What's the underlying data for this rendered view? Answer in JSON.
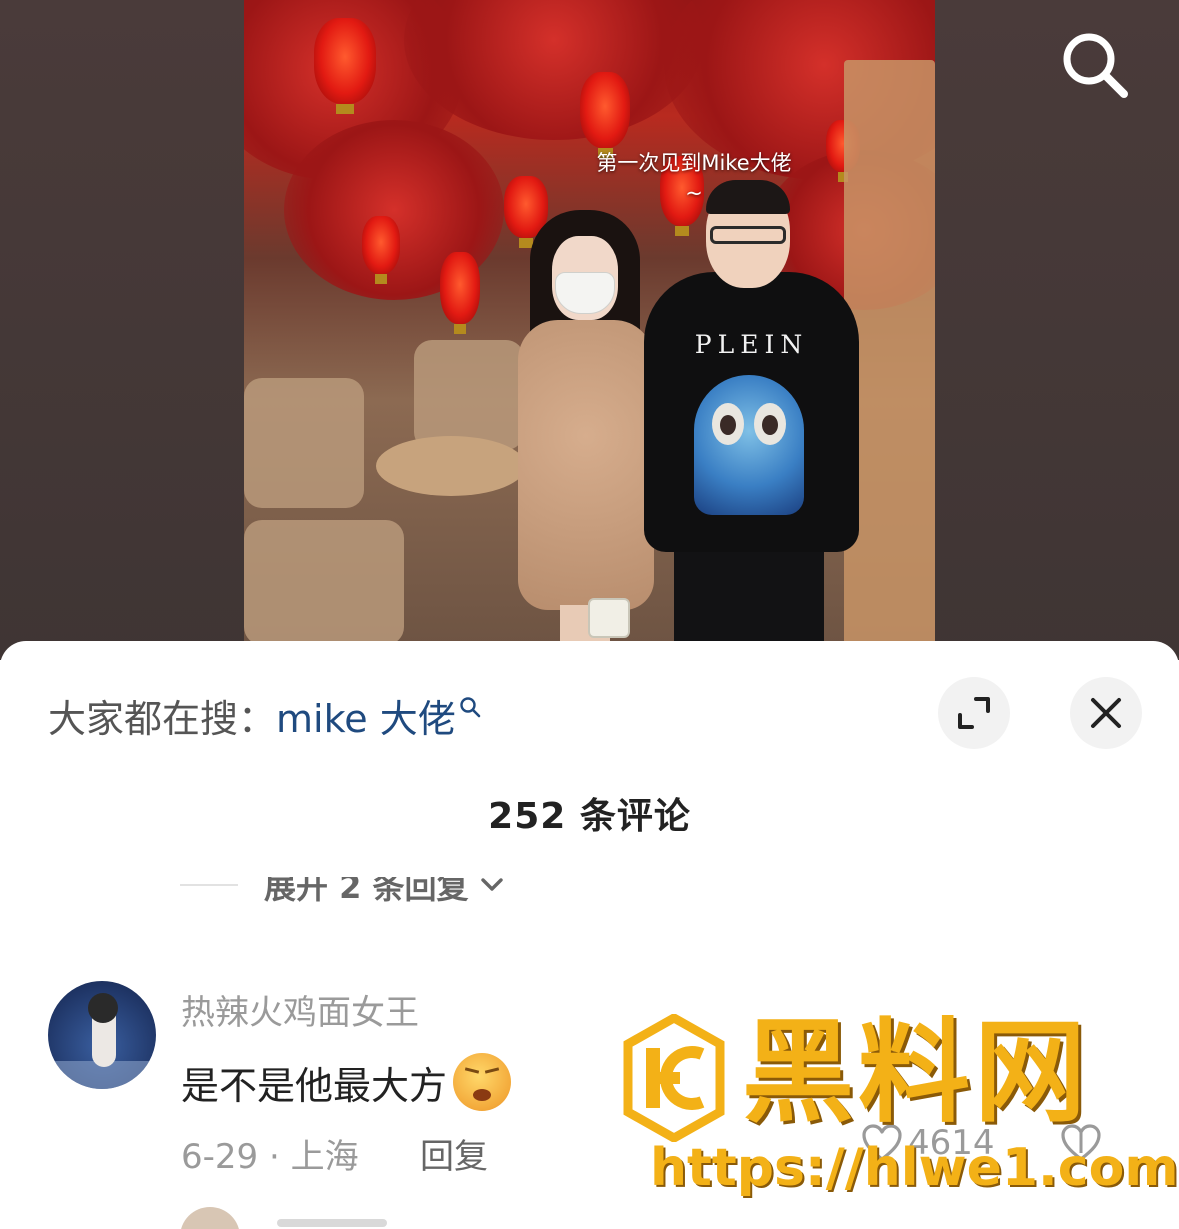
{
  "video": {
    "caption_line1": "第一次见到Mike大佬",
    "caption_line2": "~",
    "hoodie_text": "PLEIN"
  },
  "icons": {
    "search": "search-icon",
    "expand": "expand-icon",
    "close": "close-icon",
    "chevron": "chevron-down-icon",
    "like": "heart-icon",
    "dislike": "dislike-icon"
  },
  "sheet": {
    "hot_search_prefix": "大家都在搜：",
    "hot_search_keyword": "mike 大佬",
    "comment_count": "252 条评论",
    "expand_replies": "展开 2 条回复"
  },
  "comment": {
    "user": "热辣火鸡面女王",
    "text": "是不是他最大方",
    "date_location": "6-29 · 上海",
    "reply_label": "回复",
    "likes": "4614"
  },
  "watermark": {
    "title": "黑料网",
    "url": "https://hlwe1.com"
  },
  "colors": {
    "keyword": "#1f4a7f",
    "watermark": "#f3b117"
  }
}
